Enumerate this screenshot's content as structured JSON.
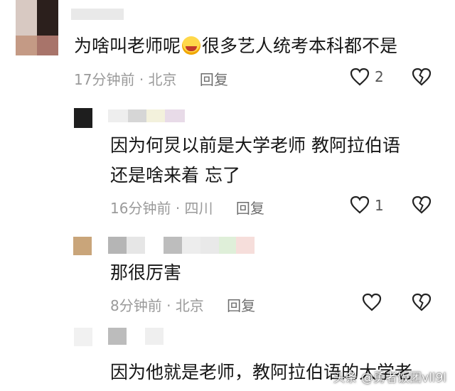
{
  "comments": [
    {
      "text": "为啥叫老师呢",
      "text_after_emoji": "很多艺人统考本科都不是",
      "emoji": "laughing-crying-emoji",
      "time": "17分钟前",
      "location": "北京",
      "reply_label": "回复",
      "like_count": "2"
    },
    {
      "text_line1": "因为何炅以前是大学老师   教阿拉伯语",
      "text_line2": "还是啥来着   忘了",
      "time": "16分钟前",
      "location": "四川",
      "reply_label": "回复",
      "like_count": "1"
    },
    {
      "text": "那很厉害",
      "time": "8分钟前",
      "location": "北京",
      "reply_label": "回复",
      "like_count": ""
    },
    {
      "text": "因为他就是老师，教阿拉伯语的大学老"
    }
  ],
  "separator": "·",
  "watermark": "头条 @勇者饭团vll9l",
  "colors": {
    "meta": "#9a9a9a",
    "text": "#161616"
  }
}
